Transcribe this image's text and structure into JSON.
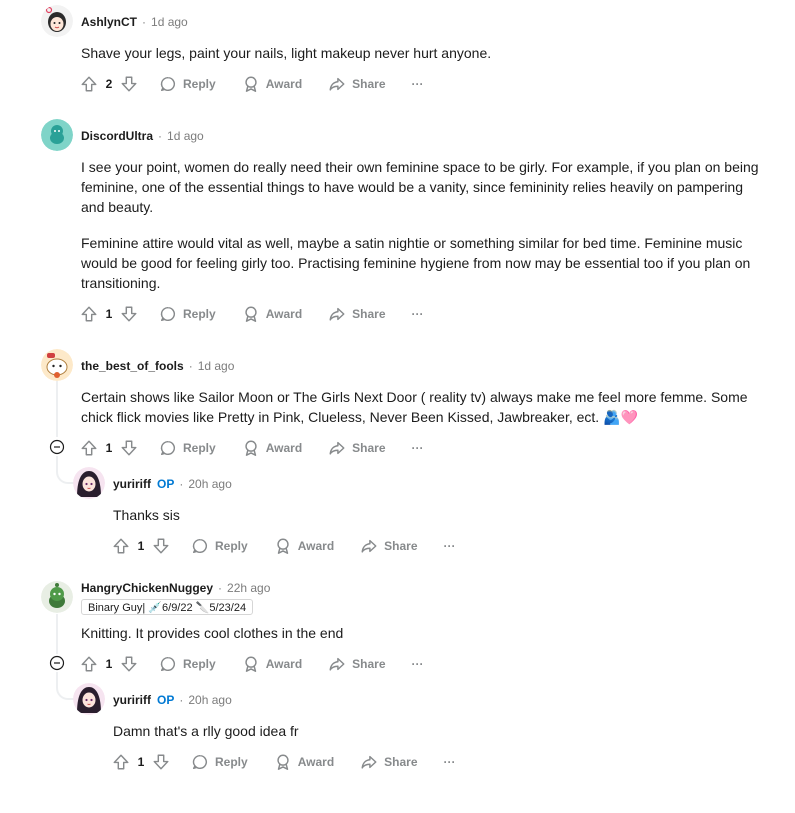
{
  "labels": {
    "reply": "Reply",
    "award": "Award",
    "share": "Share",
    "more": "···",
    "op": "OP",
    "dot": "·"
  },
  "comments": [
    {
      "username": "AshlynCT",
      "time": "1d ago",
      "body": [
        "Shave your legs, paint your nails, light makeup never hurt anyone."
      ],
      "votes": "2",
      "avatar": "girl-avatar"
    },
    {
      "username": "DiscordUltra",
      "time": "1d ago",
      "body": [
        "I see your point, women do really need their own feminine space to be girly. For example, if you plan on being feminine, one of the essential things to have would be a vanity, since femininity relies heavily on pampering and beauty.",
        "Feminine attire would vital as well, maybe a satin nightie or something similar for bed time. Feminine music would be good for feeling girly too. Practising feminine hygiene from now may be essential too if you plan on transitioning."
      ],
      "votes": "1",
      "avatar": "teal-snoo-avatar"
    },
    {
      "username": "the_best_of_fools",
      "time": "1d ago",
      "body": [
        "Certain shows like Sailor Moon or The Girls Next Door ( reality tv) always make me feel more femme. Some chick flick movies like Pretty in Pink, Clueless, Never Been Kissed, Jawbreaker, ect. 🫂🩷"
      ],
      "votes": "1",
      "avatar": "cat-avatar"
    },
    {
      "username": "yuririff",
      "op": true,
      "time": "20h ago",
      "body": [
        "Thanks sis"
      ],
      "votes": "1",
      "avatar": "anime-avatar"
    },
    {
      "username": "HangryChickenNuggey",
      "time": "22h ago",
      "flair": "Binary Guy| 💉6/9/22 🔪5/23/24",
      "body": [
        "Knitting. It provides cool clothes in the end"
      ],
      "votes": "1",
      "avatar": "green-snoo-avatar"
    },
    {
      "username": "yuririff",
      "op": true,
      "time": "20h ago",
      "body": [
        "Damn that's a rlly good idea fr"
      ],
      "votes": "1",
      "avatar": "anime-avatar"
    }
  ],
  "colors": {
    "op": "#0079d3",
    "meta": "#7c7c7c",
    "action": "#878a8c",
    "thread": "#edeff1"
  }
}
